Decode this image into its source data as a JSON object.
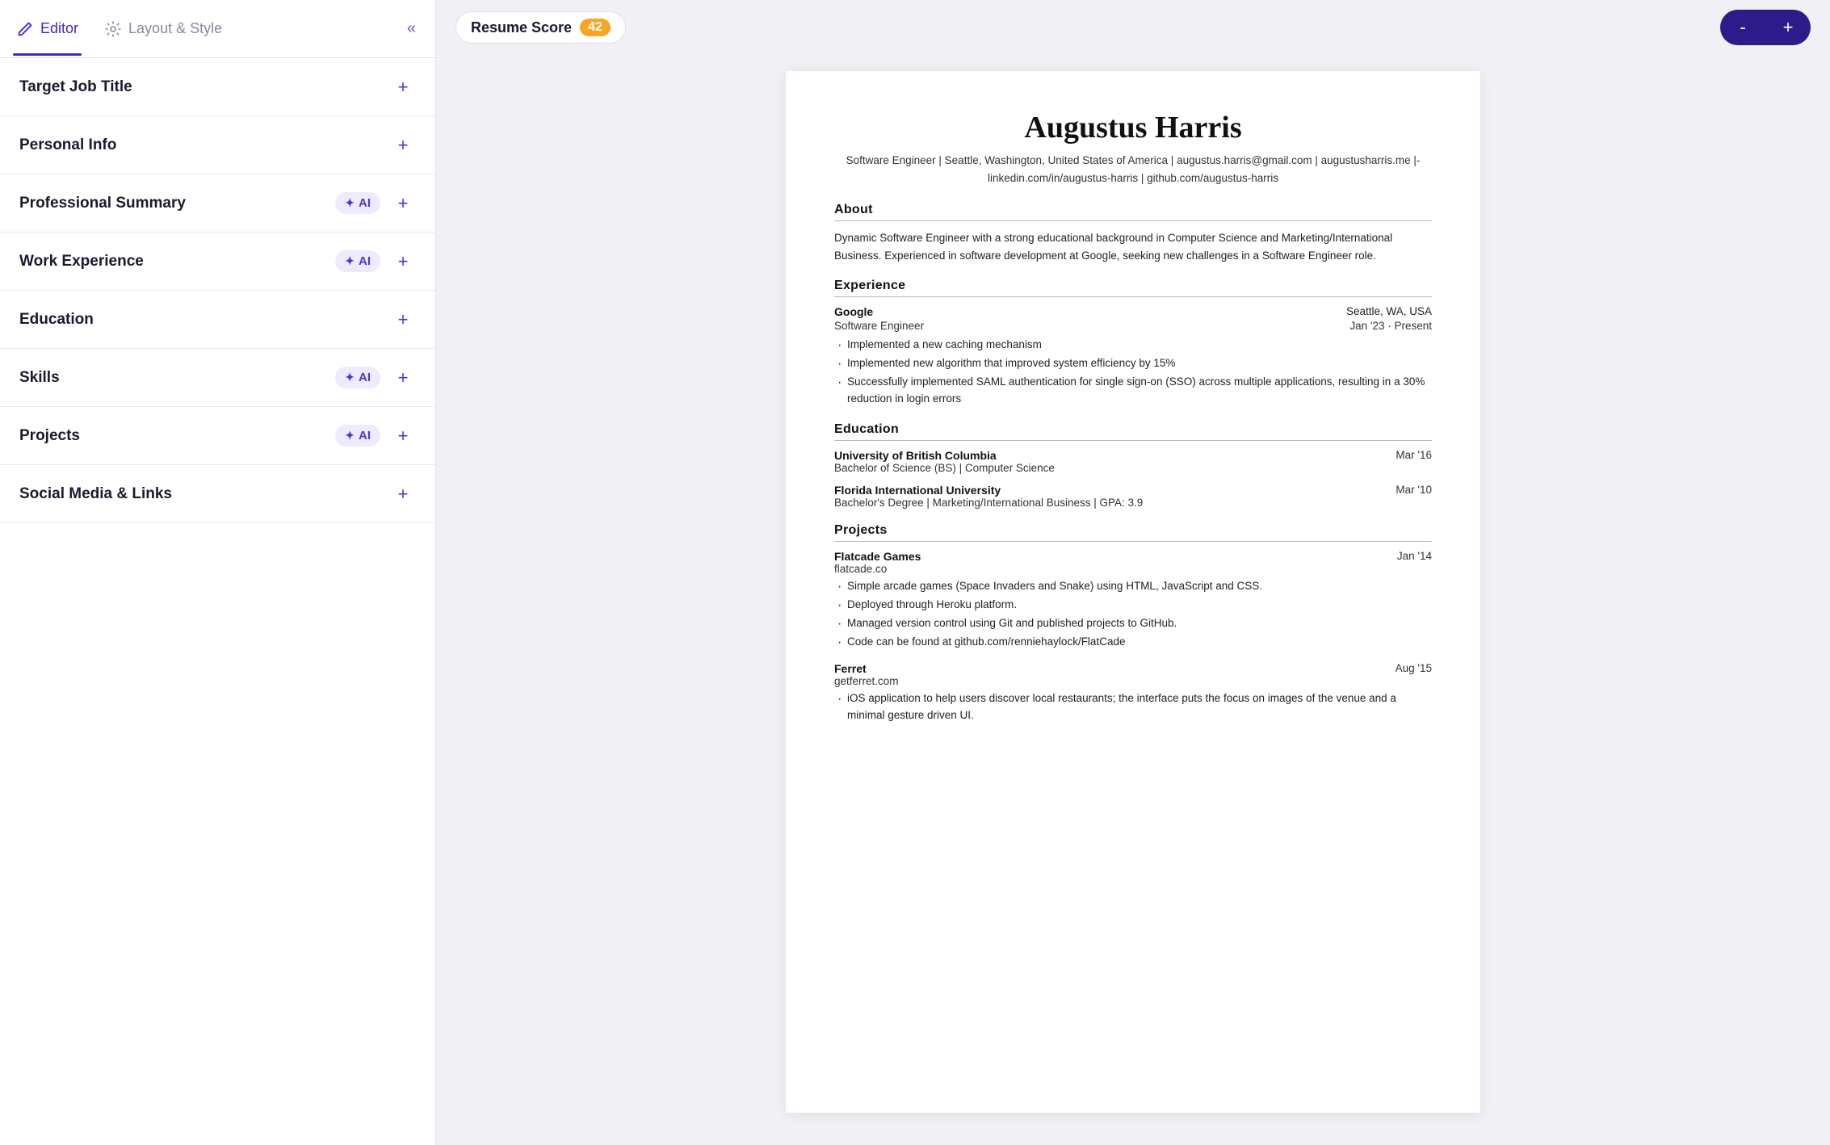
{
  "tabs": [
    {
      "id": "editor",
      "label": "Editor",
      "active": true
    },
    {
      "id": "layout-style",
      "label": "Layout & Style",
      "active": false
    }
  ],
  "collapseButton": "«",
  "sections": [
    {
      "id": "target-job-title",
      "label": "Target Job Title",
      "hasAI": false
    },
    {
      "id": "personal-info",
      "label": "Personal Info",
      "hasAI": false
    },
    {
      "id": "professional-summary",
      "label": "Professional Summary",
      "hasAI": true
    },
    {
      "id": "work-experience",
      "label": "Work Experience",
      "hasAI": true
    },
    {
      "id": "education",
      "label": "Education",
      "hasAI": false
    },
    {
      "id": "skills",
      "label": "Skills",
      "hasAI": true
    },
    {
      "id": "projects",
      "label": "Projects",
      "hasAI": true
    },
    {
      "id": "social-media-links",
      "label": "Social Media & Links",
      "hasAI": false
    }
  ],
  "ai_label": "AI",
  "plus_symbol": "+",
  "topbar": {
    "resume_score_label": "Resume Score",
    "score": "42",
    "zoom_minus": "-",
    "zoom_plus": "+"
  },
  "resume": {
    "name": "Augustus Harris",
    "contact_line1": "Software Engineer  |  Seattle, Washington, United States of America  |  augustus.harris@gmail.com  |  augustusharris.me  |-",
    "contact_line2": "linkedin.com/in/augustus-harris  |  github.com/augustus-harris",
    "sections": {
      "about": {
        "title": "About",
        "text": "Dynamic Software Engineer with a strong educational background in Computer Science and Marketing/International Business. Experienced in software development at Google, seeking new challenges in a Software Engineer role."
      },
      "experience": {
        "title": "Experience",
        "jobs": [
          {
            "company": "Google",
            "location": "Seattle, WA, USA",
            "title": "Software Engineer",
            "dates": "Jan '23 · Present",
            "bullets": [
              "Implemented a new caching mechanism",
              "Implemented new algorithm that improved system efficiency by 15%",
              "Successfully implemented SAML authentication for single sign-on (SSO) across multiple applications, resulting in a 30% reduction in login errors"
            ]
          }
        ]
      },
      "education": {
        "title": "Education",
        "items": [
          {
            "school": "University of British Columbia",
            "date": "Mar '16",
            "degree": "Bachelor of Science (BS) | Computer Science"
          },
          {
            "school": "Florida International University",
            "date": "Mar '10",
            "degree": "Bachelor's Degree | Marketing/International Business | GPA: 3.9"
          }
        ]
      },
      "projects": {
        "title": "Projects",
        "items": [
          {
            "name": "Flatcade Games",
            "date": "Jan '14",
            "url": "flatcade.co",
            "bullets": [
              "Simple arcade games (Space Invaders and Snake) using HTML, JavaScript and CSS.",
              "Deployed through Heroku platform.",
              "Managed version control using Git and published projects to GitHub.",
              "Code can be found at github.com/renniehaylock/FlatCade"
            ]
          },
          {
            "name": "Ferret",
            "date": "Aug '15",
            "url": "getferret.com",
            "bullets": [
              "iOS application to help users discover local restaurants; the interface puts the focus on images of the venue and a minimal gesture driven UI."
            ]
          }
        ]
      }
    }
  }
}
